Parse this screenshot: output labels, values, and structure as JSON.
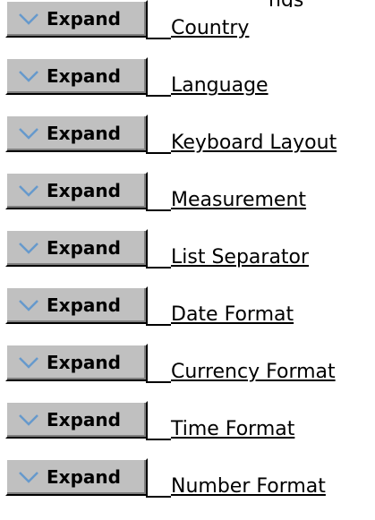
{
  "top_fragment": "ngs",
  "expand_label": "Expand",
  "items": [
    {
      "label": "Country"
    },
    {
      "label": "Language"
    },
    {
      "label": "Keyboard Layout"
    },
    {
      "label": "Measurement"
    },
    {
      "label": "List Separator"
    },
    {
      "label": "Date Format"
    },
    {
      "label": "Currency Format"
    },
    {
      "label": "Time Format"
    },
    {
      "label": "Number Format"
    }
  ],
  "icons": {
    "expand": "chevron-down-icon"
  },
  "colors": {
    "button_face": "#c0c0c0",
    "button_highlight": "#ffffff",
    "button_shadow": "#808080",
    "chevron": "#6699cc",
    "text": "#000000",
    "background": "#ffffff"
  }
}
